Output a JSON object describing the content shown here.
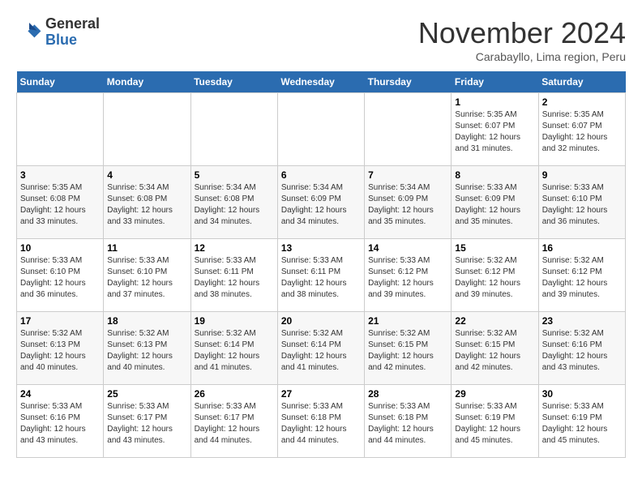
{
  "logo": {
    "general": "General",
    "blue": "Blue"
  },
  "header": {
    "title": "November 2024",
    "subtitle": "Carabayllo, Lima region, Peru"
  },
  "weekdays": [
    "Sunday",
    "Monday",
    "Tuesday",
    "Wednesday",
    "Thursday",
    "Friday",
    "Saturday"
  ],
  "weeks": [
    [
      {
        "day": "",
        "info": ""
      },
      {
        "day": "",
        "info": ""
      },
      {
        "day": "",
        "info": ""
      },
      {
        "day": "",
        "info": ""
      },
      {
        "day": "",
        "info": ""
      },
      {
        "day": "1",
        "info": "Sunrise: 5:35 AM\nSunset: 6:07 PM\nDaylight: 12 hours and 31 minutes."
      },
      {
        "day": "2",
        "info": "Sunrise: 5:35 AM\nSunset: 6:07 PM\nDaylight: 12 hours and 32 minutes."
      }
    ],
    [
      {
        "day": "3",
        "info": "Sunrise: 5:35 AM\nSunset: 6:08 PM\nDaylight: 12 hours and 33 minutes."
      },
      {
        "day": "4",
        "info": "Sunrise: 5:34 AM\nSunset: 6:08 PM\nDaylight: 12 hours and 33 minutes."
      },
      {
        "day": "5",
        "info": "Sunrise: 5:34 AM\nSunset: 6:08 PM\nDaylight: 12 hours and 34 minutes."
      },
      {
        "day": "6",
        "info": "Sunrise: 5:34 AM\nSunset: 6:09 PM\nDaylight: 12 hours and 34 minutes."
      },
      {
        "day": "7",
        "info": "Sunrise: 5:34 AM\nSunset: 6:09 PM\nDaylight: 12 hours and 35 minutes."
      },
      {
        "day": "8",
        "info": "Sunrise: 5:33 AM\nSunset: 6:09 PM\nDaylight: 12 hours and 35 minutes."
      },
      {
        "day": "9",
        "info": "Sunrise: 5:33 AM\nSunset: 6:10 PM\nDaylight: 12 hours and 36 minutes."
      }
    ],
    [
      {
        "day": "10",
        "info": "Sunrise: 5:33 AM\nSunset: 6:10 PM\nDaylight: 12 hours and 36 minutes."
      },
      {
        "day": "11",
        "info": "Sunrise: 5:33 AM\nSunset: 6:10 PM\nDaylight: 12 hours and 37 minutes."
      },
      {
        "day": "12",
        "info": "Sunrise: 5:33 AM\nSunset: 6:11 PM\nDaylight: 12 hours and 38 minutes."
      },
      {
        "day": "13",
        "info": "Sunrise: 5:33 AM\nSunset: 6:11 PM\nDaylight: 12 hours and 38 minutes."
      },
      {
        "day": "14",
        "info": "Sunrise: 5:33 AM\nSunset: 6:12 PM\nDaylight: 12 hours and 39 minutes."
      },
      {
        "day": "15",
        "info": "Sunrise: 5:32 AM\nSunset: 6:12 PM\nDaylight: 12 hours and 39 minutes."
      },
      {
        "day": "16",
        "info": "Sunrise: 5:32 AM\nSunset: 6:12 PM\nDaylight: 12 hours and 39 minutes."
      }
    ],
    [
      {
        "day": "17",
        "info": "Sunrise: 5:32 AM\nSunset: 6:13 PM\nDaylight: 12 hours and 40 minutes."
      },
      {
        "day": "18",
        "info": "Sunrise: 5:32 AM\nSunset: 6:13 PM\nDaylight: 12 hours and 40 minutes."
      },
      {
        "day": "19",
        "info": "Sunrise: 5:32 AM\nSunset: 6:14 PM\nDaylight: 12 hours and 41 minutes."
      },
      {
        "day": "20",
        "info": "Sunrise: 5:32 AM\nSunset: 6:14 PM\nDaylight: 12 hours and 41 minutes."
      },
      {
        "day": "21",
        "info": "Sunrise: 5:32 AM\nSunset: 6:15 PM\nDaylight: 12 hours and 42 minutes."
      },
      {
        "day": "22",
        "info": "Sunrise: 5:32 AM\nSunset: 6:15 PM\nDaylight: 12 hours and 42 minutes."
      },
      {
        "day": "23",
        "info": "Sunrise: 5:32 AM\nSunset: 6:16 PM\nDaylight: 12 hours and 43 minutes."
      }
    ],
    [
      {
        "day": "24",
        "info": "Sunrise: 5:33 AM\nSunset: 6:16 PM\nDaylight: 12 hours and 43 minutes."
      },
      {
        "day": "25",
        "info": "Sunrise: 5:33 AM\nSunset: 6:17 PM\nDaylight: 12 hours and 43 minutes."
      },
      {
        "day": "26",
        "info": "Sunrise: 5:33 AM\nSunset: 6:17 PM\nDaylight: 12 hours and 44 minutes."
      },
      {
        "day": "27",
        "info": "Sunrise: 5:33 AM\nSunset: 6:18 PM\nDaylight: 12 hours and 44 minutes."
      },
      {
        "day": "28",
        "info": "Sunrise: 5:33 AM\nSunset: 6:18 PM\nDaylight: 12 hours and 44 minutes."
      },
      {
        "day": "29",
        "info": "Sunrise: 5:33 AM\nSunset: 6:19 PM\nDaylight: 12 hours and 45 minutes."
      },
      {
        "day": "30",
        "info": "Sunrise: 5:33 AM\nSunset: 6:19 PM\nDaylight: 12 hours and 45 minutes."
      }
    ]
  ]
}
